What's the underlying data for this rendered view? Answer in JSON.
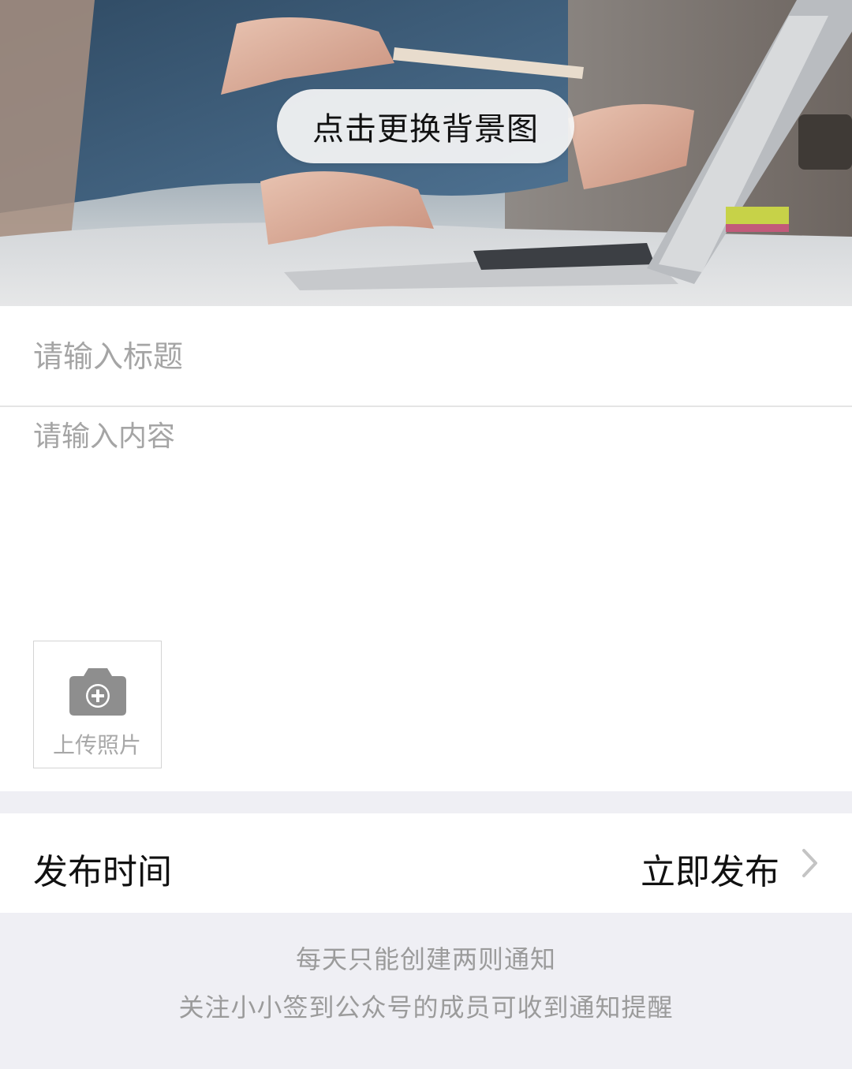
{
  "header": {
    "change_background_label": "点击更换背景图"
  },
  "form": {
    "title_placeholder": "请输入标题",
    "content_placeholder": "请输入内容",
    "upload_label": "上传照片",
    "upload_icon": "camera-plus-icon"
  },
  "publish": {
    "label": "发布时间",
    "value": "立即发布",
    "chevron_icon": "chevron-right-icon"
  },
  "notes": {
    "line1": "每天只能创建两则通知",
    "line2": "关注小小签到公众号的成员可收到通知提醒"
  },
  "colors": {
    "page_background": "#efeff4",
    "placeholder": "#a5a5a5",
    "note_text": "#9b9b9b"
  }
}
